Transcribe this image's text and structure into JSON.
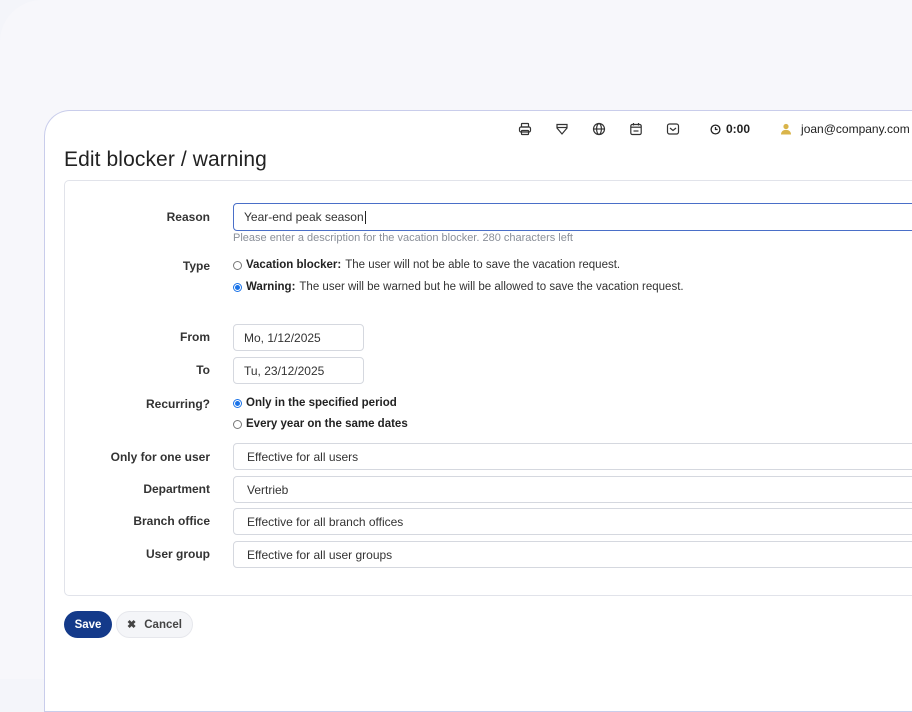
{
  "header": {
    "timer": "0:00",
    "user_email": "joan@company.com",
    "icons": [
      "printer-icon",
      "tag-icon",
      "globe-icon",
      "calendar-icon",
      "inbox-icon"
    ]
  },
  "page": {
    "title": "Edit blocker / warning"
  },
  "form": {
    "reason": {
      "label": "Reason",
      "value": "Year-end peak season",
      "help": "Please enter a description for the vacation blocker. 280 characters left"
    },
    "type": {
      "label": "Type",
      "options": [
        {
          "title": "Vacation blocker:",
          "desc": "The user will not be able to save the vacation request.",
          "selected": false
        },
        {
          "title": "Warning:",
          "desc": "The user will be warned but he will be allowed to save the vacation request.",
          "selected": true
        }
      ]
    },
    "from": {
      "label": "From",
      "value": "Mo, 1/12/2025"
    },
    "to": {
      "label": "To",
      "value": "Tu, 23/12/2025"
    },
    "recurring": {
      "label": "Recurring?",
      "options": [
        {
          "title": "Only in the specified period",
          "selected": true
        },
        {
          "title": "Every year on the same dates",
          "selected": false
        }
      ]
    },
    "only_user": {
      "label": "Only for one user",
      "value": "Effective for all users"
    },
    "department": {
      "label": "Department",
      "value": "Vertrieb"
    },
    "branch": {
      "label": "Branch office",
      "value": "Effective for all branch offices"
    },
    "group": {
      "label": "User group",
      "value": "Effective for all user groups"
    }
  },
  "actions": {
    "save": "Save",
    "cancel": "Cancel"
  },
  "colors": {
    "primary": "#143a8a",
    "radio_accent": "#1a73e8",
    "user_icon": "#d9b44a"
  }
}
